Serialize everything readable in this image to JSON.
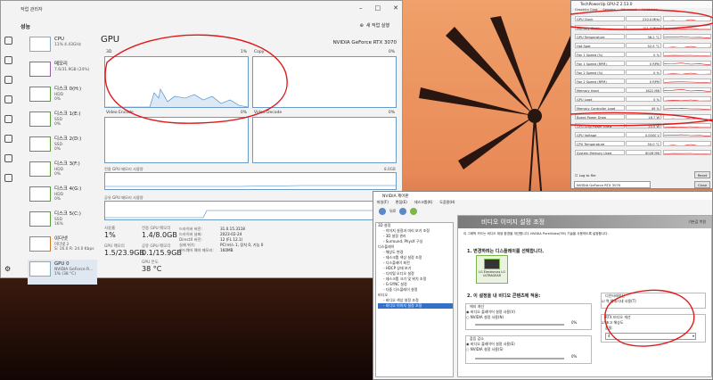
{
  "taskmgr": {
    "title": "작업 관리자",
    "section": "성능",
    "new_task": "새 작업 실행",
    "items": [
      {
        "name": "CPU",
        "sub": "11% 4.43GHz"
      },
      {
        "name": "메모리",
        "sub": "7.6/31.9GB (24%)"
      },
      {
        "name": "디스크 0(H:)",
        "sub": "HDD",
        "sub2": "0%"
      },
      {
        "name": "디스크 1(E:)",
        "sub": "SSD",
        "sub2": "0%"
      },
      {
        "name": "디스크 2(D:)",
        "sub": "SSD",
        "sub2": "0%"
      },
      {
        "name": "디스크 3(F:)",
        "sub": "HDD",
        "sub2": "0%"
      },
      {
        "name": "디스크 4(G:)",
        "sub": "HDD",
        "sub2": "0%"
      },
      {
        "name": "디스크 5(C:)",
        "sub": "SSD",
        "sub2": "16%"
      },
      {
        "name": "이더넷",
        "sub": "이더넷 2",
        "sub2": "S: 16.0 R: 24.0 Kbps"
      },
      {
        "name": "GPU 0",
        "sub": "NVIDIA GeForce R...",
        "sub2": "1% (38 °C)"
      }
    ],
    "gpu_title": "GPU",
    "gpu_name": "NVIDIA GeForce RTX 3070",
    "graph_3d": "3D",
    "graph_3d_pct": "1%",
    "graph_copy": "Copy",
    "graph_copy_pct": "0%",
    "graph_venc": "Video Encode",
    "graph_venc_pct": "0%",
    "graph_vdec": "Video Decode",
    "graph_vdec_pct": "0%",
    "ded_mem_label": "전용 GPU 메모리 사용량",
    "ded_mem_max": "8.0GB",
    "shared_mem_label": "공유 GPU 메모리 사용량",
    "shared_mem_max": "16.0GB",
    "stats": [
      {
        "k": "사용률",
        "v": "1%"
      },
      {
        "k": "전용 GPU 메모리",
        "v": "1.4/8.0GB"
      },
      {
        "k": "GPU 메모리",
        "v": "1.5/23.9GB"
      },
      {
        "k": "공유 GPU 메모리",
        "v": "0.1/15.9GB"
      },
      {
        "k": "GPU 온도",
        "v": "38 °C"
      }
    ],
    "driver": [
      {
        "k": "드라이버 버전:",
        "v": "31.0.15.3118"
      },
      {
        "k": "드라이버 날짜:",
        "v": "2023-02-24"
      },
      {
        "k": "DirectX 버전:",
        "v": "12 (FL 12.1)"
      },
      {
        "k": "실제 위치:",
        "v": "PCI 버스 1, 장치 0, 기능 0"
      },
      {
        "k": "하드웨어 예약 메모리:",
        "v": "160MB"
      }
    ]
  },
  "gpuz": {
    "title": "TechPowerUp GPU-Z 2.53.0",
    "tabs": [
      "Graphics Card",
      "Sensors",
      "Advanced",
      "Validation"
    ],
    "rows": [
      {
        "name": "GPU Clock",
        "value": "210.0 MHz"
      },
      {
        "name": "Memory Clock",
        "value": "101.3 MHz"
      },
      {
        "name": "GPU Temperature",
        "value": "38.2 °C"
      },
      {
        "name": "Hot Spot",
        "value": "52.5 °C"
      },
      {
        "name": "Fan 1 Speed (%)",
        "value": "0 %"
      },
      {
        "name": "Fan 1 Speed (RPM)",
        "value": "0 RPM"
      },
      {
        "name": "Fan 2 Speed (%)",
        "value": "0 %"
      },
      {
        "name": "Fan 2 Speed (RPM)",
        "value": "0 RPM"
      },
      {
        "name": "Memory Used",
        "value": "1622 MB"
      },
      {
        "name": "GPU Load",
        "value": "0 %"
      },
      {
        "name": "Memory Controller Load",
        "value": "49 %"
      },
      {
        "name": "Board Power Draw",
        "value": "18.7 W"
      },
      {
        "name": "GPU Chip Power Draw",
        "value": "20.0 W"
      },
      {
        "name": "GPU Voltage",
        "value": "0.0000 V"
      },
      {
        "name": "CPU Temperature",
        "value": "50.0 °C"
      },
      {
        "name": "System Memory Used",
        "value": "8028 MB"
      }
    ],
    "log_label": "Log to file",
    "reset": "Reset",
    "device": "NVIDIA GeForce RTX 3070",
    "close": "Close"
  },
  "nvcp": {
    "title": "NVIDIA 제어판",
    "menu": [
      "파일(F)",
      "편집(E)",
      "데스크톱(K)",
      "도움말(H)"
    ],
    "back": "뒤로",
    "tree": [
      "3D 설정",
      "- 이미지 설정과 미리 보기 조정",
      "- 3D 설정 관리",
      "- Surround, PhysX 구성",
      "디스플레이",
      "- 해상도 변경",
      "- 데스크톱 색상 설정 조정",
      "- 디스플레이 회전",
      "- HDCP 상태 보기",
      "- 디지털 오디오 설정",
      "- 데스크톱 크기 및 위치 조정",
      "- G-SYNC 설정",
      "- 다중 디스플레이 설정",
      "비디오",
      "- 비디오 색상 설정 조정",
      "- 비디오 이미지 설정 조정"
    ],
    "banner": "비디오 이미지 설정 조정",
    "restore": "기본값 복원",
    "desc": "이 그래픽 카드는 비디오 재생 환경을 개선합니다. NVIDIA PureVideo(TM) 기술을 사용하도록 설정합니다.",
    "step1": "1. 변경하려는 디스플레이를 선택합니다.",
    "display_name": "LG Electronics LG ULTRAGEAR",
    "step2": "2. 이 설정을 내 비디오 콘텐츠에 적용:",
    "edge_title": "에지 개선",
    "edge_opt1": "비디오 플레이어 설정 사용(V)",
    "edge_opt2": "NVIDIA 설정 사용(N)",
    "edge_val": "0%",
    "noise_title": "잡음 감소",
    "noise_opt1": "비디오 플레이어 설정 사용(E)",
    "noise_opt2": "NVIDIA 설정 사용(S)",
    "noise_val": "0%",
    "deint_title": "디인터레이싱",
    "deint_opt": "역 텔레시네 사용(T)",
    "rtx_title": "RTX 비디오 개선",
    "rtx_opt": "초고 해상도",
    "rtx_quality_label": "품질:",
    "rtx_quality": "4"
  }
}
